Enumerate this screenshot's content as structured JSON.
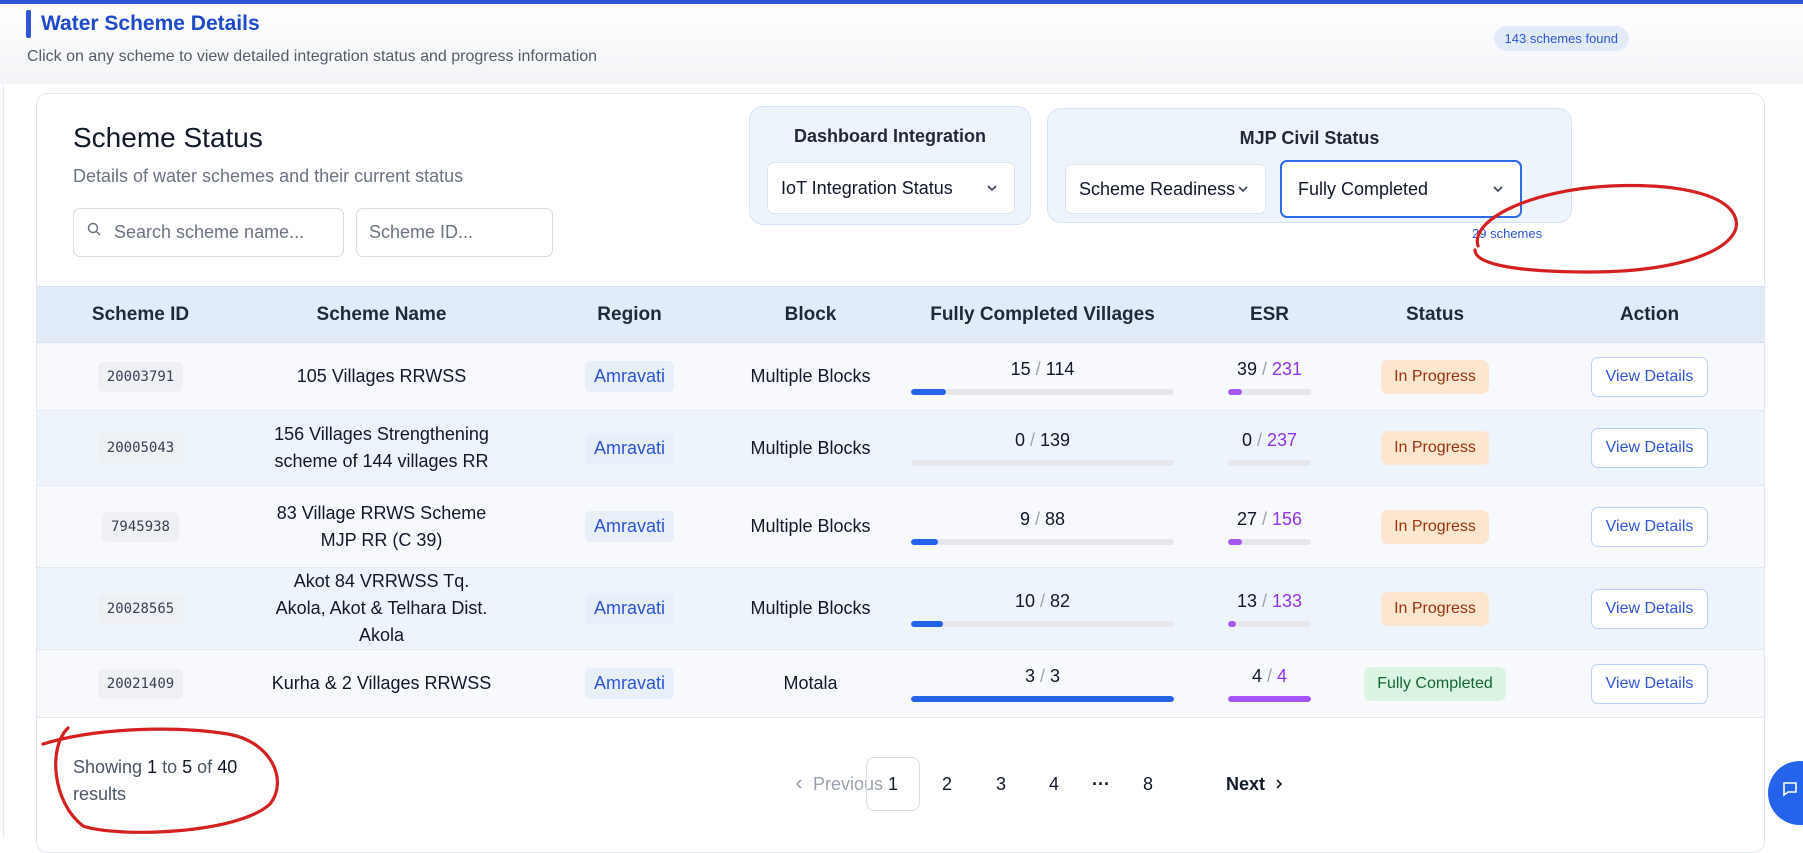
{
  "header": {
    "title": "Water Scheme Details",
    "subtitle": "Click on any scheme to view detailed integration status and progress information",
    "count_badge": "143 schemes found"
  },
  "card": {
    "title": "Scheme Status",
    "subtitle": "Details of water schemes and their current status",
    "search_placeholder": "Search scheme name...",
    "id_placeholder": "Scheme ID..."
  },
  "dashboard_panel": {
    "title": "Dashboard Integration",
    "select_value": "IoT Integration Status"
  },
  "civil_panel": {
    "title": "MJP Civil Status",
    "readiness_value": "Scheme Readiness",
    "completion_value": "Fully Completed",
    "schemes_count": "29 schemes"
  },
  "table": {
    "columns": [
      "Scheme ID",
      "Scheme Name",
      "Region",
      "Block",
      "Fully Completed Villages",
      "ESR",
      "Status",
      "Action"
    ],
    "rows": [
      {
        "id": "20003791",
        "name": "105 Villages RRWSS",
        "region": "Amravati",
        "block": "Multiple Blocks",
        "villages_done": "15",
        "villages_total": "114",
        "villages_frac": 0.1316,
        "esr_done": "39",
        "esr_total": "231",
        "esr_frac": 0.1688,
        "status": "In Progress",
        "status_kind": "progress",
        "action": "View Details"
      },
      {
        "id": "20005043",
        "name": "156 Villages Strengthening scheme of 144 villages RR",
        "region": "Amravati",
        "block": "Multiple Blocks",
        "villages_done": "0",
        "villages_total": "139",
        "villages_frac": 0,
        "esr_done": "0",
        "esr_total": "237",
        "esr_frac": 0,
        "status": "In Progress",
        "status_kind": "progress",
        "action": "View Details"
      },
      {
        "id": "7945938",
        "name": "83 Village RRWS Scheme MJP RR (C 39)",
        "region": "Amravati",
        "block": "Multiple Blocks",
        "villages_done": "9",
        "villages_total": "88",
        "villages_frac": 0.1023,
        "esr_done": "27",
        "esr_total": "156",
        "esr_frac": 0.1731,
        "status": "In Progress",
        "status_kind": "progress",
        "action": "View Details"
      },
      {
        "id": "20028565",
        "name": "Akot 84 VRRWSS Tq. Akola, Akot & Telhara Dist. Akola",
        "region": "Amravati",
        "block": "Multiple Blocks",
        "villages_done": "10",
        "villages_total": "82",
        "villages_frac": 0.122,
        "esr_done": "13",
        "esr_total": "133",
        "esr_frac": 0.0977,
        "status": "In Progress",
        "status_kind": "progress",
        "action": "View Details"
      },
      {
        "id": "20021409",
        "name": "Kurha & 2 Villages RRWSS",
        "region": "Amravati",
        "block": "Motala",
        "villages_done": "3",
        "villages_total": "3",
        "villages_frac": 1,
        "esr_done": "4",
        "esr_total": "4",
        "esr_frac": 1,
        "status": "Fully Completed",
        "status_kind": "done",
        "action": "View Details"
      }
    ]
  },
  "footer": {
    "showing_prefix": "Showing",
    "from": "1",
    "to_word": "to",
    "to": "5",
    "of_word": "of",
    "total": "40",
    "results_word": "results"
  },
  "pagination": {
    "previous": "Previous",
    "pages": [
      "1",
      "2",
      "3",
      "4"
    ],
    "ellipsis": "···",
    "last": "8",
    "next": "Next",
    "current": "1"
  },
  "colors": {
    "accent": "#2f55d4",
    "progress_bar": "#2563eb",
    "esr_bar": "#a855f7",
    "annotation": "#d42020"
  }
}
